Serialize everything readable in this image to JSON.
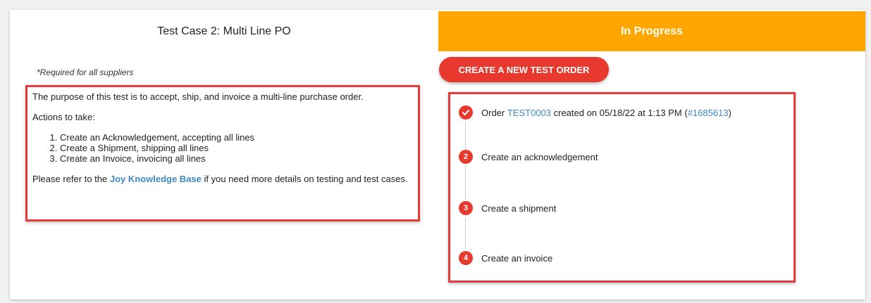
{
  "test_case": {
    "title": "Test Case 2: Multi Line PO",
    "required_note": "*Required for all suppliers",
    "purpose": "The purpose of this test is to accept, ship, and invoice a multi-line purchase order.",
    "actions_heading": "Actions to take:",
    "actions": [
      "Create an Acknowledgement, accepting all lines",
      "Create a Shipment, shipping all lines",
      "Create an Invoice, invoicing all lines"
    ],
    "refer_prefix": "Please refer to the ",
    "kb_link": "Joy Knowledge Base",
    "refer_suffix": " if you need more details on testing and test cases."
  },
  "status": {
    "label": "In Progress",
    "color": "#ffa600"
  },
  "create_button": {
    "label": "CREATE A NEW TEST ORDER",
    "color": "#e8392f"
  },
  "steps": {
    "step1": {
      "icon": "checkmark-icon",
      "prefix": "Order ",
      "order_link": "TEST0003",
      "middle": " created on 05/18/22 at 1:13 PM (",
      "po_link": "#1685613",
      "suffix": ")"
    },
    "step2": {
      "number": "2",
      "label": "Create an acknowledgement"
    },
    "step3": {
      "number": "3",
      "label": "Create a shipment"
    },
    "step4": {
      "number": "4",
      "label": "Create an invoice"
    }
  }
}
